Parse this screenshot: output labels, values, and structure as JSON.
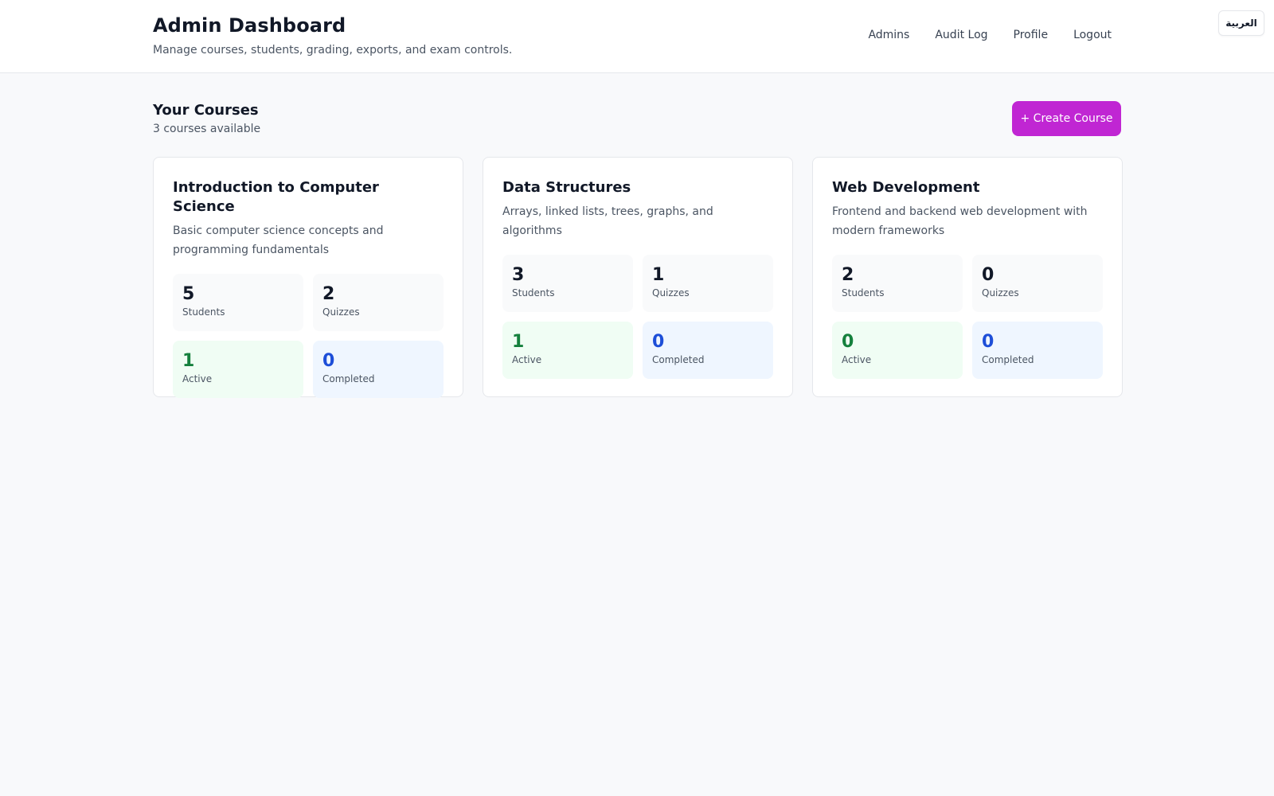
{
  "header": {
    "title": "Admin Dashboard",
    "subtitle": "Manage courses, students, grading, exports, and exam controls.",
    "nav": [
      "Admins",
      "Audit Log",
      "Profile",
      "Logout"
    ],
    "language_button": "العربية"
  },
  "courses_section": {
    "title": "Your Courses",
    "count_text": "3 courses available",
    "create_button": "+ Create Course"
  },
  "courses": [
    {
      "title": "Introduction to Computer Science",
      "description": "Basic computer science concepts and programming fundamentals",
      "stats": {
        "students": {
          "value": "5",
          "label": "Students"
        },
        "quizzes": {
          "value": "2",
          "label": "Quizzes"
        },
        "active": {
          "value": "1",
          "label": "Active"
        },
        "completed": {
          "value": "0",
          "label": "Completed"
        }
      }
    },
    {
      "title": "Data Structures",
      "description": "Arrays, linked lists, trees, graphs, and algorithms",
      "stats": {
        "students": {
          "value": "3",
          "label": "Students"
        },
        "quizzes": {
          "value": "1",
          "label": "Quizzes"
        },
        "active": {
          "value": "1",
          "label": "Active"
        },
        "completed": {
          "value": "0",
          "label": "Completed"
        }
      }
    },
    {
      "title": "Web Development",
      "description": "Frontend and backend web development with modern frameworks",
      "stats": {
        "students": {
          "value": "2",
          "label": "Students"
        },
        "quizzes": {
          "value": "0",
          "label": "Quizzes"
        },
        "active": {
          "value": "0",
          "label": "Active"
        },
        "completed": {
          "value": "0",
          "label": "Completed"
        }
      }
    }
  ],
  "colors": {
    "accent": "#c026d3",
    "active_text": "#15803d",
    "active_bg": "#f0fdf4",
    "completed_text": "#1d4ed8",
    "completed_bg": "#eff6ff"
  }
}
